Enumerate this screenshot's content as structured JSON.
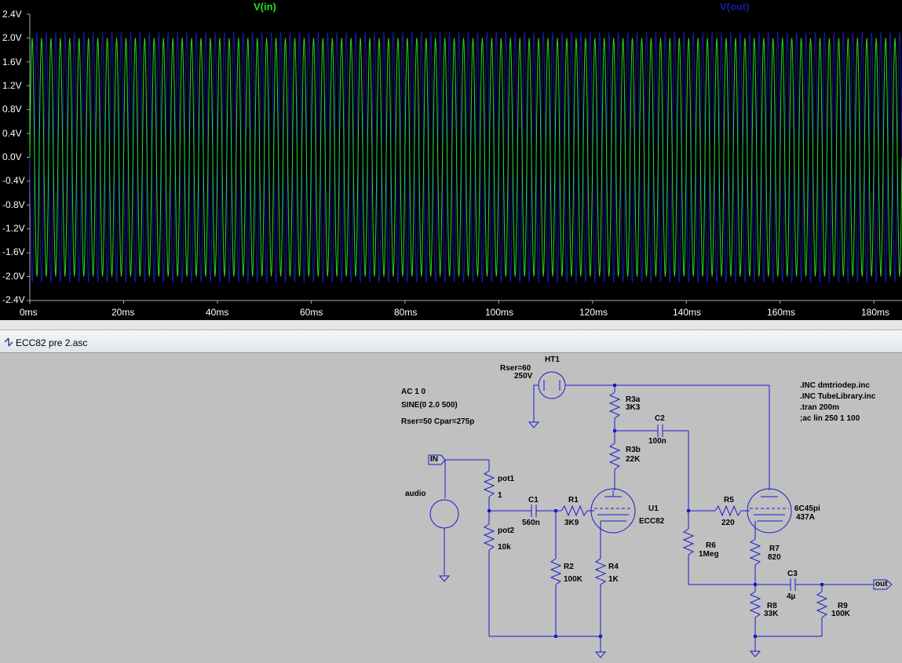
{
  "window": {
    "document_tab": "ECC82 pre 2.asc",
    "tab_icon": "schematic-doc-icon"
  },
  "plot": {
    "legend": {
      "vin": "V(in)",
      "vout": "V(out)"
    },
    "y_ticks": [
      "2.4V",
      "2.0V",
      "1.6V",
      "1.2V",
      "0.8V",
      "0.4V",
      "0.0V",
      "-0.4V",
      "-0.8V",
      "-1.2V",
      "-1.6V",
      "-2.0V",
      "-2.4V"
    ],
    "x_ticks": [
      "0ms",
      "20ms",
      "40ms",
      "60ms",
      "80ms",
      "100ms",
      "120ms",
      "140ms",
      "160ms",
      "180ms"
    ],
    "colors": {
      "background": "#000000",
      "vin": "#22dd22",
      "vout": "#1a1aa8",
      "text": "#ffffff"
    }
  },
  "chart_data": {
    "type": "line",
    "x_range_ms": [
      0,
      186
    ],
    "y_range_v": [
      -2.4,
      2.4
    ],
    "series": [
      {
        "name": "V(in)",
        "shape": "sine",
        "amplitude_v": 2.0,
        "frequency_hz": 500
      },
      {
        "name": "V(out)",
        "shape": "sine",
        "amplitude_v": 2.1,
        "frequency_hz": 500
      }
    ]
  },
  "schematic": {
    "directives": {
      "ac": "AC 1 0",
      "sine": "SINE(0 2.0 500)",
      "source_params": "Rser=50 Cpar=275p",
      "inc1": ".INC dmtriodep.inc",
      "inc2": ".INC TubeLibrary.inc",
      "tran": ".tran 200m",
      "ac_sweep": ";ac lin 250 1 100"
    },
    "flags": {
      "in": "IN",
      "out": "out"
    },
    "components": {
      "ht1_name": "HT1",
      "ht1_rser": "Rser=60",
      "ht1_value": "250V",
      "audio_name": "audio",
      "pot1_name": "pot1",
      "pot1_value": "1",
      "pot2_name": "pot2",
      "pot2_value": "10k",
      "c1_name": "C1",
      "c1_value": "560n",
      "r1_name": "R1",
      "r1_value": "3K9",
      "r2_name": "R2",
      "r2_value": "100K",
      "r3a_name": "R3a",
      "r3a_value": "3K3",
      "r3b_name": "R3b",
      "r3b_value": "22K",
      "r4_name": "R4",
      "r4_value": "1K",
      "u1_name": "U1",
      "u1_value": "ECC82",
      "c2_name": "C2",
      "c2_value": "100n",
      "r5_name": "R5",
      "r5_value": "220",
      "r6_name": "R6",
      "r6_value": "1Meg",
      "tube2_name": "6C45pi",
      "tube2_value": "437A",
      "r7_name": "R7",
      "r7_value": "820",
      "c3_name": "C3",
      "c3_value": "4µ",
      "r8_name": "R8",
      "r8_value": "33K",
      "r9_name": "R9",
      "r9_value": "100K"
    }
  }
}
